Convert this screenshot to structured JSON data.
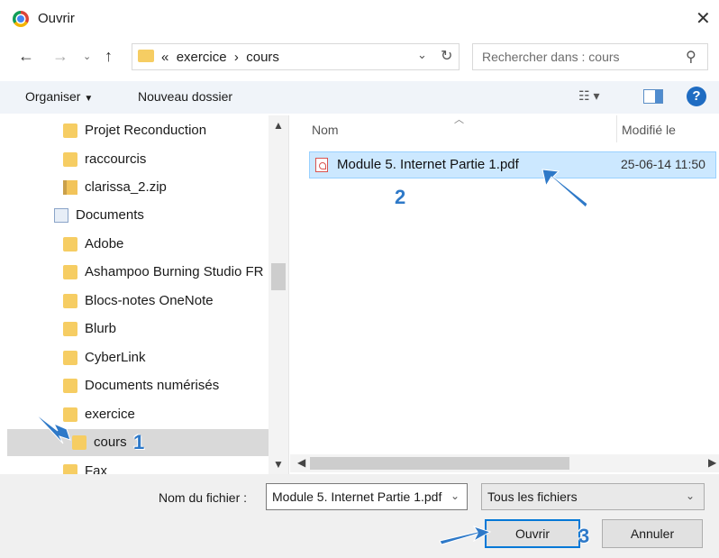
{
  "window": {
    "title": "Ouvrir"
  },
  "address": {
    "path_prefix": "«",
    "segments": [
      "exercice",
      "cours"
    ],
    "separator": "›"
  },
  "search": {
    "placeholder": "Rechercher dans : cours"
  },
  "toolbar": {
    "organize": "Organiser",
    "new_folder": "Nouveau dossier"
  },
  "tree": [
    {
      "label": "Projet Reconduction",
      "icon": "folder-icon",
      "indent": 1
    },
    {
      "label": "raccourcis",
      "icon": "folder-icon",
      "indent": 1
    },
    {
      "label": "clarissa_2.zip",
      "icon": "zip-icon",
      "indent": 1
    },
    {
      "label": "Documents",
      "icon": "documents-icon",
      "indent": 0
    },
    {
      "label": "Adobe",
      "icon": "folder-icon",
      "indent": 1
    },
    {
      "label": "Ashampoo Burning Studio FR",
      "icon": "folder-icon",
      "indent": 1
    },
    {
      "label": "Blocs-notes OneNote",
      "icon": "folder-icon",
      "indent": 1
    },
    {
      "label": "Blurb",
      "icon": "folder-icon",
      "indent": 1
    },
    {
      "label": "CyberLink",
      "icon": "folder-icon",
      "indent": 1
    },
    {
      "label": "Documents numérisés",
      "icon": "folder-icon",
      "indent": 1
    },
    {
      "label": "exercice",
      "icon": "folder-icon",
      "indent": 1
    },
    {
      "label": "cours",
      "icon": "folder-icon",
      "indent": 2,
      "selected": true
    },
    {
      "label": "Fax",
      "icon": "folder-icon",
      "indent": 1
    }
  ],
  "columns": {
    "name": "Nom",
    "modified": "Modifié le"
  },
  "files": [
    {
      "name": "Module 5. Internet Partie 1.pdf",
      "modified": "25-06-14 11:50",
      "icon": "pdf-icon"
    }
  ],
  "bottom": {
    "filename_label": "Nom du fichier :",
    "filename_value": "Module 5. Internet Partie 1.pdf",
    "filetype_value": "Tous les fichiers",
    "open_label": "Ouvrir",
    "cancel_label": "Annuler"
  },
  "annotations": [
    "1",
    "2",
    "3"
  ],
  "colors": {
    "accent": "#0078d7",
    "selection": "#cce8ff",
    "annotation": "#2e79c8"
  }
}
